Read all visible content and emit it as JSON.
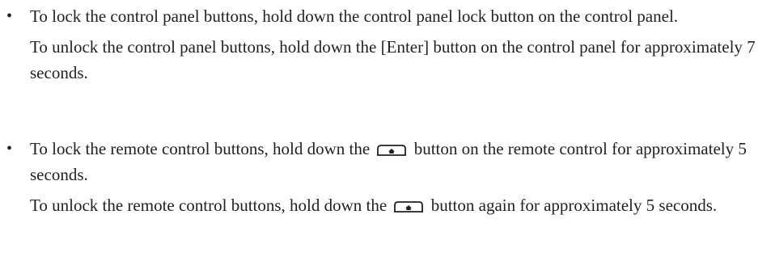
{
  "document": {
    "bullet_symbol": "•",
    "items": [
      {
        "p1": "To lock the control panel buttons, hold down the control panel lock button on the control panel.",
        "p2": "To unlock the control panel buttons, hold down the [Enter] button on the control panel for approximately 7 seconds."
      },
      {
        "p1_before": "To lock the remote control buttons, hold down the",
        "p1_after": "button on the remote control for approximately 5 seconds.",
        "p2_before": "To unlock the remote control buttons, hold down the",
        "p2_after": "button again for approximately 5 seconds."
      }
    ],
    "icon_name": "home-button-icon"
  }
}
